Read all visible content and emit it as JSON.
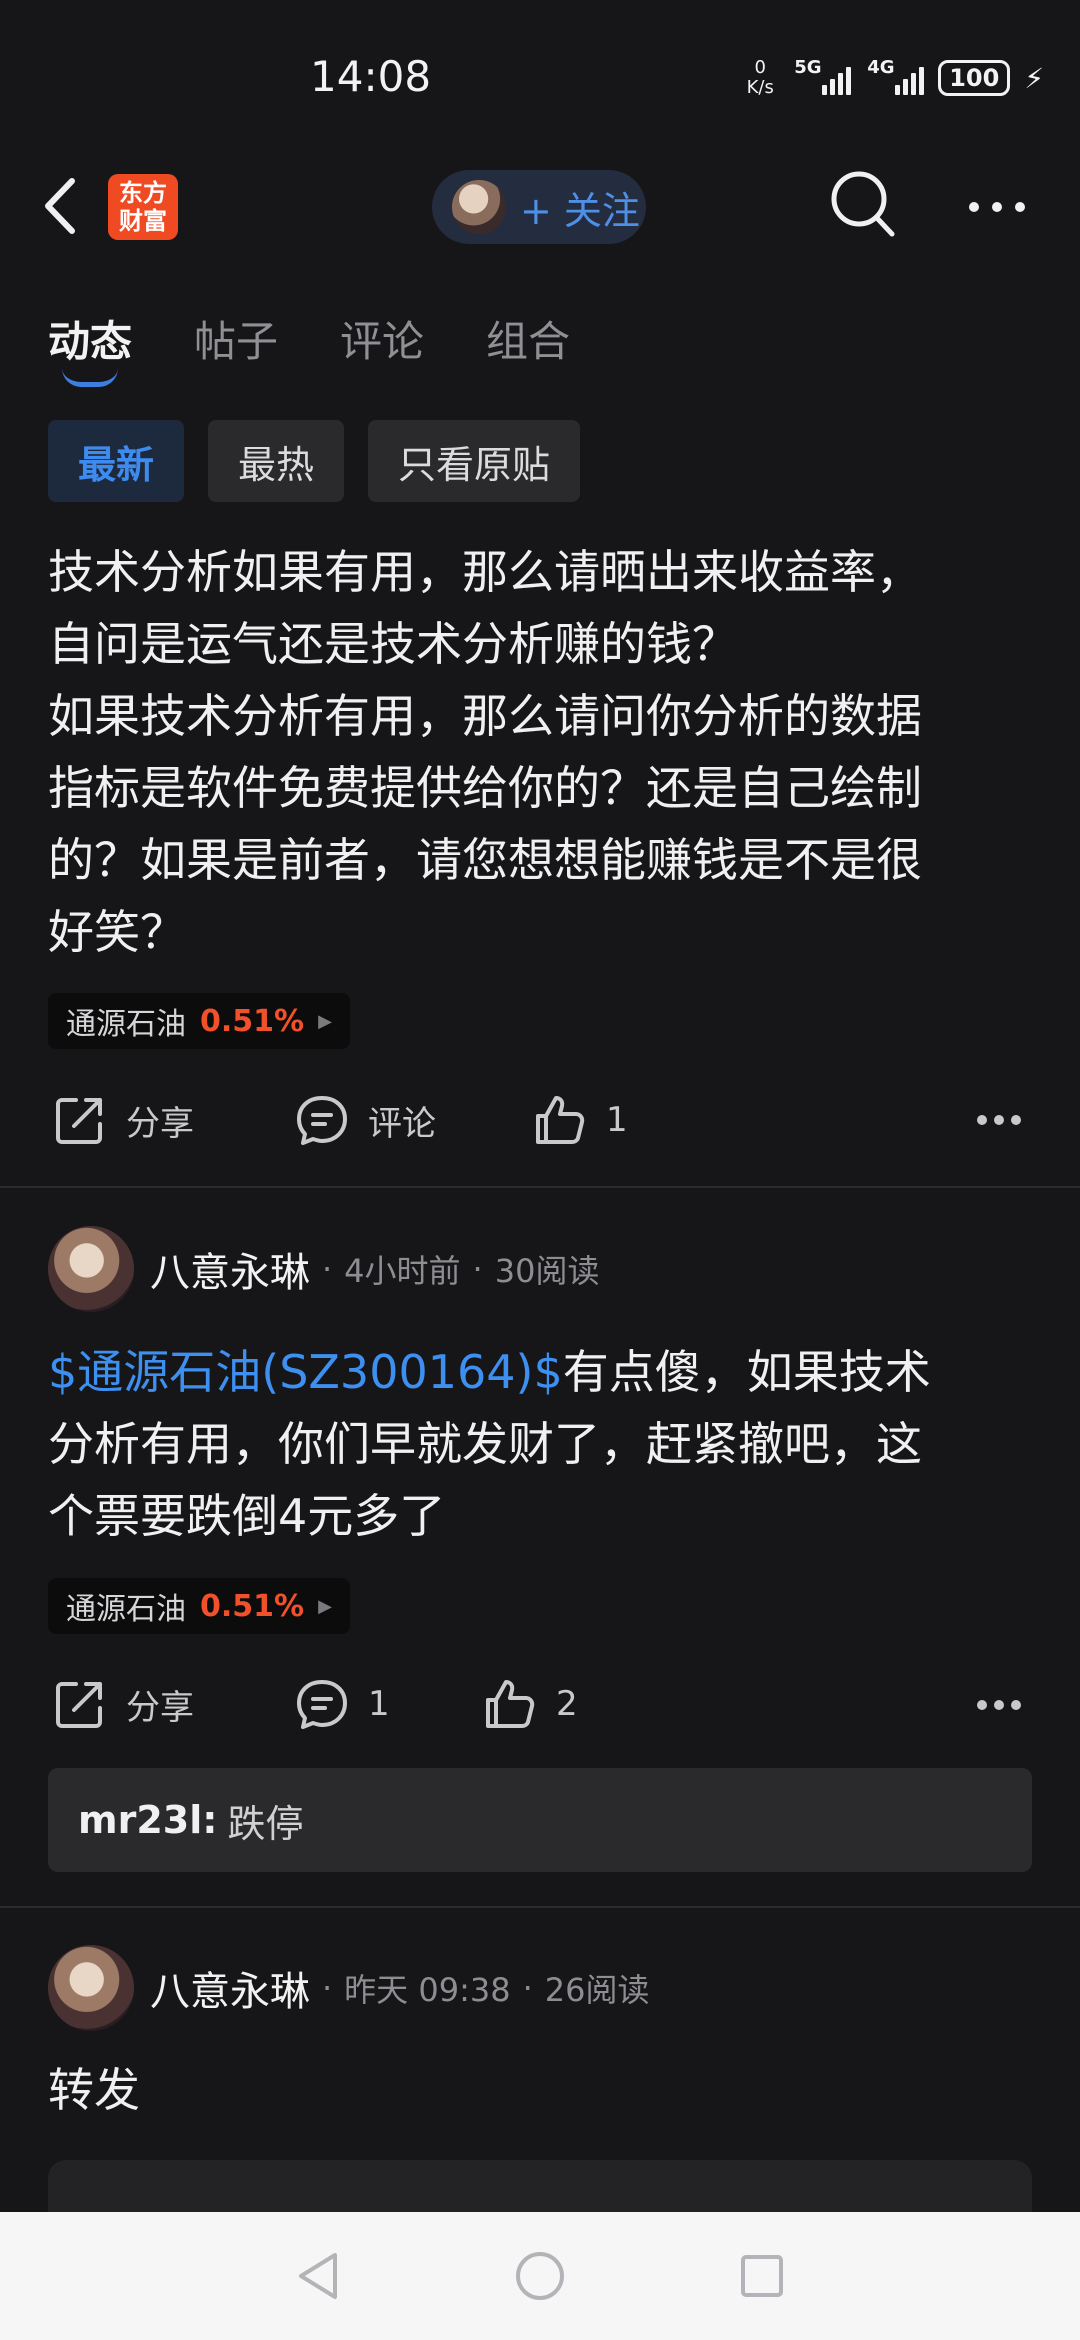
{
  "status_bar": {
    "time": "14:08",
    "net_speed_value": "0",
    "net_speed_unit": "K/s",
    "signal1_label": "5G",
    "signal2_label": "4G",
    "battery": "100"
  },
  "header": {
    "logo_line1": "东方",
    "logo_line2": "财富",
    "follow_label": "+ 关注"
  },
  "tabs": [
    {
      "label": "动态",
      "active": true
    },
    {
      "label": "帖子",
      "active": false
    },
    {
      "label": "评论",
      "active": false
    },
    {
      "label": "组合",
      "active": false
    }
  ],
  "filters": [
    {
      "label": "最新",
      "active": true
    },
    {
      "label": "最热",
      "active": false
    },
    {
      "label": "只看原贴",
      "active": false
    }
  ],
  "post1": {
    "text": "技术分析如果有用，那么请晒出来收益率，\n自问是运气还是技术分析赚的钱？\n如果技术分析有用，那么请问你分析的数据\n指标是软件免费提供给你的？还是自己绘制\n的？如果是前者，请您想想能赚钱是不是很\n好笑？",
    "stock_name": "通源石油",
    "stock_change": "0.51%",
    "share_label": "分享",
    "comment_label": "评论",
    "like_count": "1"
  },
  "post2": {
    "author": "八意永琳",
    "time": "4小时前",
    "reads": "30阅读",
    "stock_ref": "$通源石油(SZ300164)$",
    "text": "有点傻，如果技术\n分析有用，你们早就发财了，赶紧撤吧，这\n个票要跌倒4元多了",
    "stock_name": "通源石油",
    "stock_change": "0.51%",
    "share_label": "分享",
    "comment_count": "1",
    "like_count": "2",
    "reply_user": "mr23l:",
    "reply_text": "跌停"
  },
  "post3": {
    "author": "八意永琳",
    "time": "昨天 09:38",
    "reads": "26阅读",
    "text": "转发"
  },
  "meta_separator": "·",
  "colors": {
    "accent_blue": "#3d8ff0",
    "stock_up_red": "#f0502a",
    "logo_orange": "#f04a23",
    "background": "#161618"
  }
}
